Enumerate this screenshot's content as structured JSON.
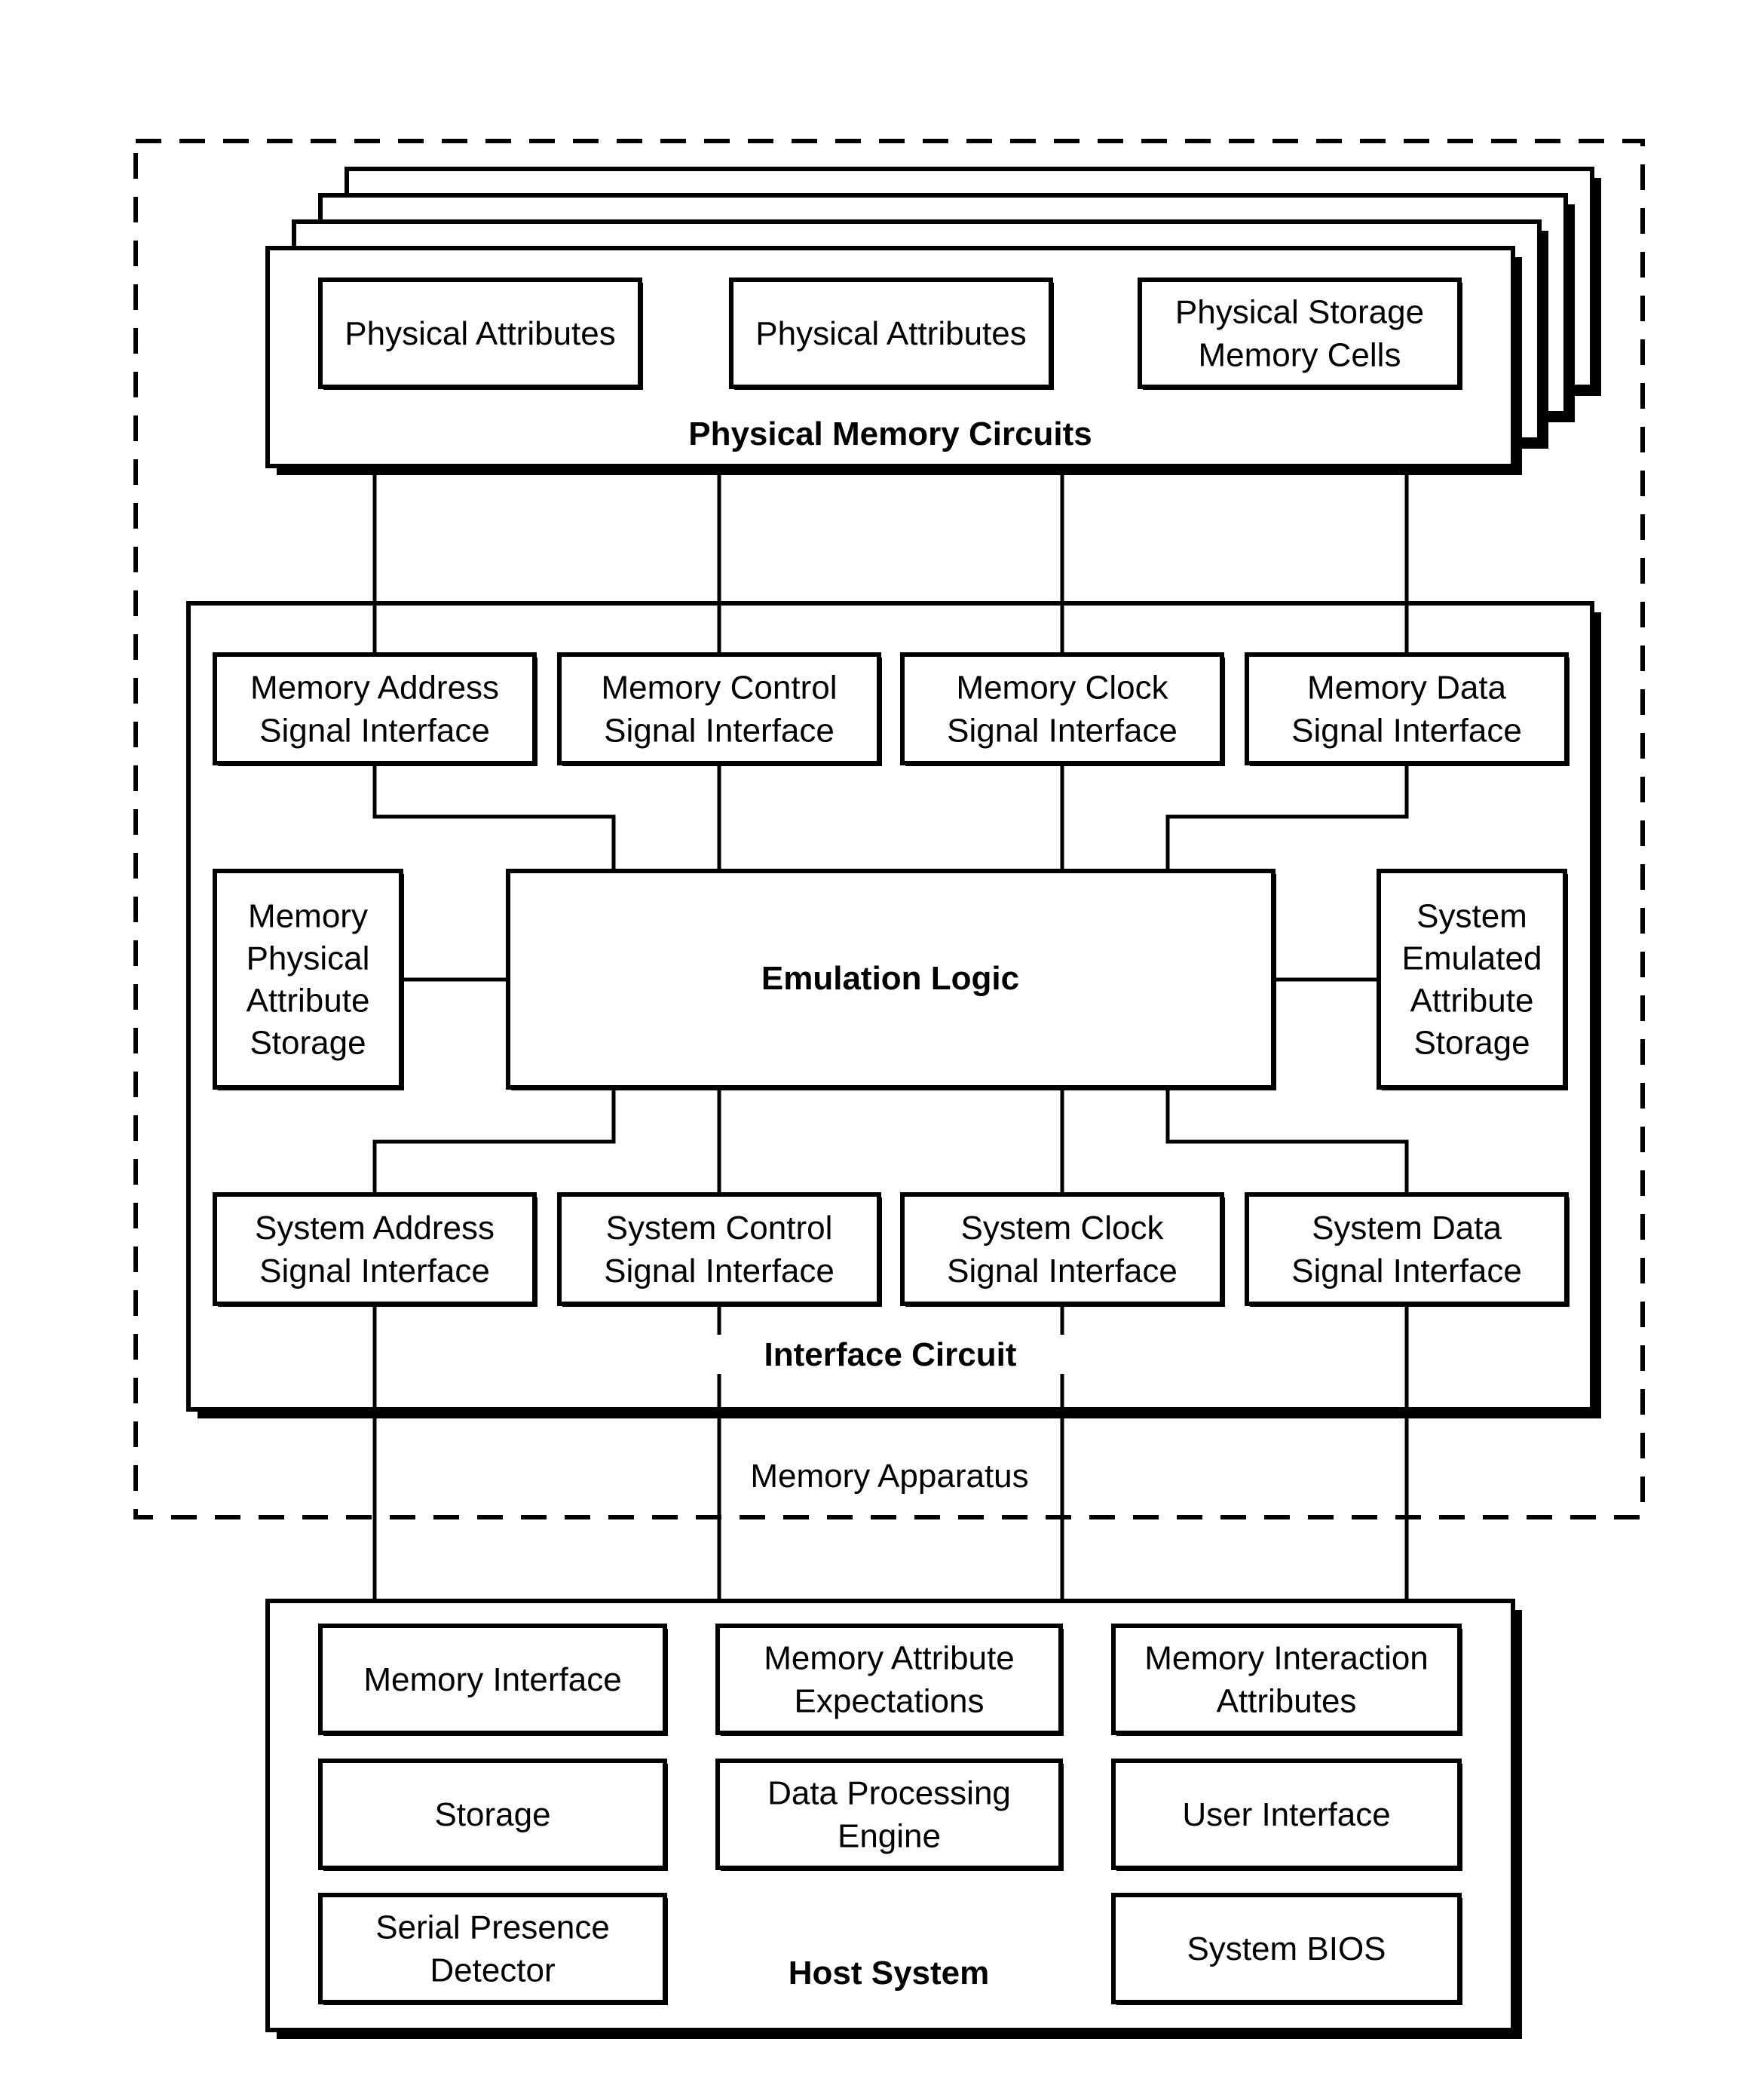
{
  "physical_memory_circuits": {
    "title": "Physical Memory Circuits",
    "stack_layers": 4,
    "blocks": [
      {
        "lines": [
          "Physical Attributes"
        ]
      },
      {
        "lines": [
          "Physical Attributes"
        ]
      },
      {
        "lines": [
          "Physical Storage",
          "Memory Cells"
        ]
      }
    ]
  },
  "interface_circuit": {
    "title": "Interface Circuit",
    "memory_side": [
      {
        "lines": [
          "Memory Address",
          "Signal Interface"
        ]
      },
      {
        "lines": [
          "Memory Control",
          "Signal Interface"
        ]
      },
      {
        "lines": [
          "Memory Clock",
          "Signal Interface"
        ]
      },
      {
        "lines": [
          "Memory Data",
          "Signal Interface"
        ]
      }
    ],
    "left_storage": {
      "lines": [
        "Memory",
        "Physical",
        "Attribute",
        "Storage"
      ]
    },
    "emulation_logic": {
      "label": "Emulation Logic"
    },
    "right_storage": {
      "lines": [
        "System",
        "Emulated",
        "Attribute",
        "Storage"
      ]
    },
    "system_side": [
      {
        "lines": [
          "System Address",
          "Signal Interface"
        ]
      },
      {
        "lines": [
          "System Control",
          "Signal Interface"
        ]
      },
      {
        "lines": [
          "System Clock",
          "Signal Interface"
        ]
      },
      {
        "lines": [
          "System Data",
          "Signal Interface"
        ]
      }
    ]
  },
  "memory_apparatus": {
    "label": "Memory Apparatus"
  },
  "host_system": {
    "title": "Host System",
    "blocks": [
      {
        "lines": [
          "Memory Interface"
        ]
      },
      {
        "lines": [
          "Memory Attribute",
          "Expectations"
        ]
      },
      {
        "lines": [
          "Memory Interaction",
          "Attributes"
        ]
      },
      {
        "lines": [
          "Storage"
        ]
      },
      {
        "lines": [
          "Data Processing",
          "Engine"
        ]
      },
      {
        "lines": [
          "User Interface"
        ]
      },
      {
        "lines": [
          "Serial Presence",
          "Detector"
        ]
      },
      {
        "lines": [
          "System BIOS"
        ]
      }
    ]
  }
}
